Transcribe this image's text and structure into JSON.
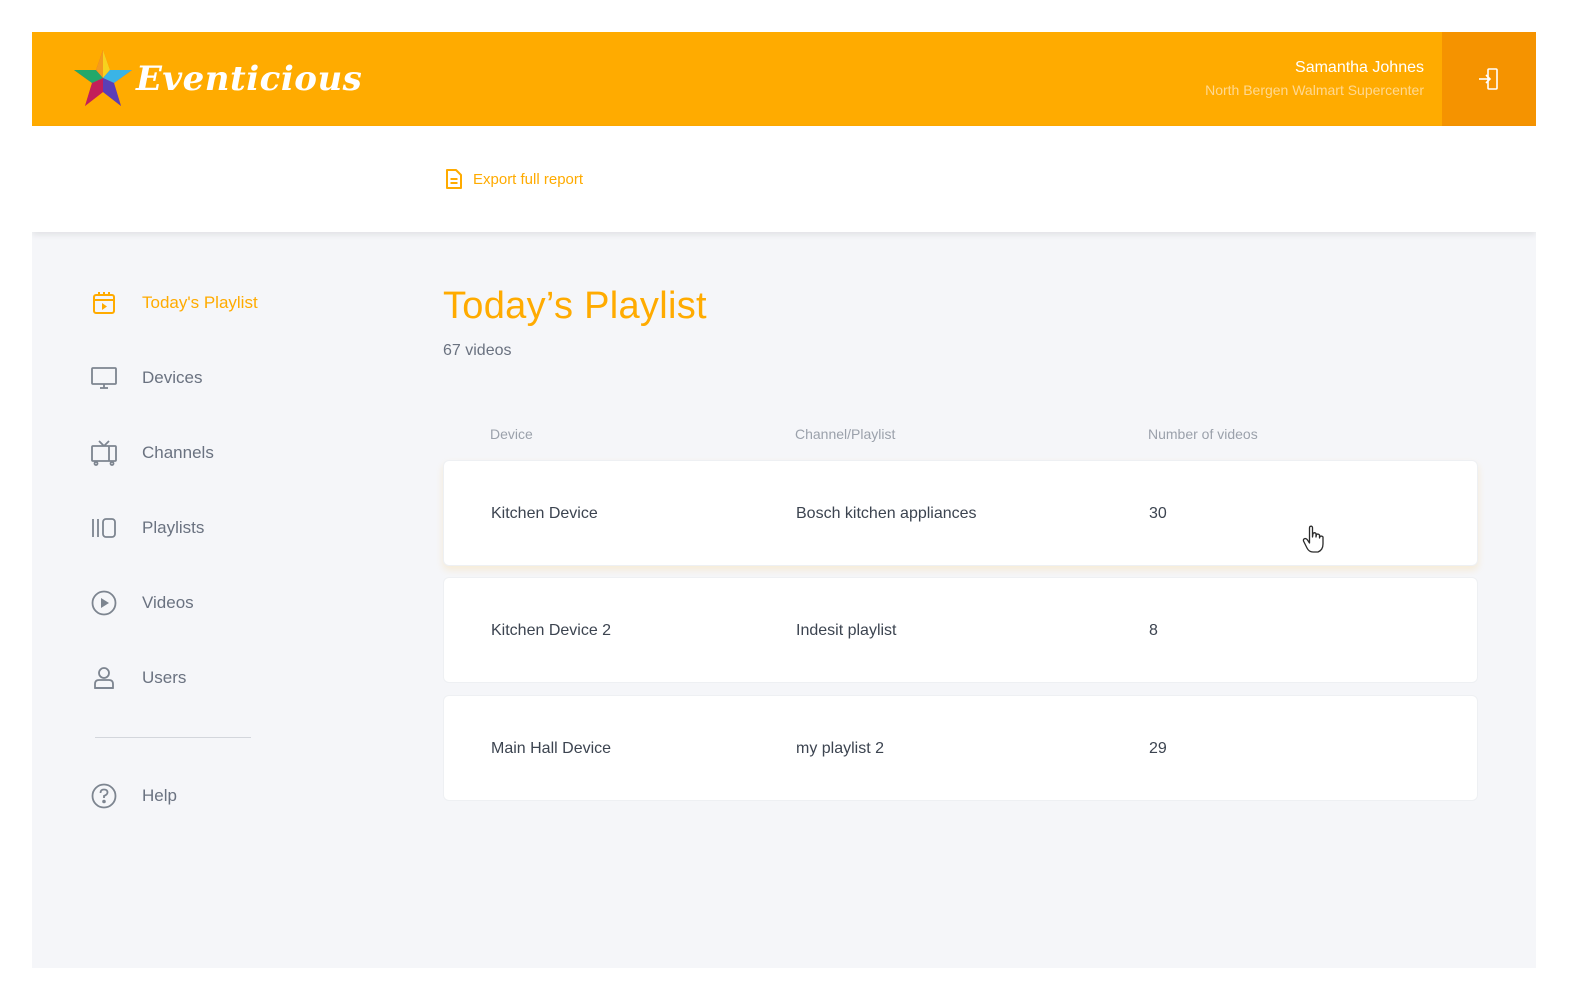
{
  "header": {
    "brand": "Eventicious",
    "user_name": "Samantha Johnes",
    "store_name": "North Bergen Walmart Supercenter",
    "logout_icon": "logout-icon"
  },
  "toolbar": {
    "export_label": "Export full report",
    "export_icon": "document-icon"
  },
  "sidebar": {
    "items": [
      {
        "label": "Today's Playlist",
        "icon": "calendar-play-icon",
        "active": true
      },
      {
        "label": "Devices",
        "icon": "monitor-icon",
        "active": false
      },
      {
        "label": "Channels",
        "icon": "tv-icon",
        "active": false
      },
      {
        "label": "Playlists",
        "icon": "playlists-icon",
        "active": false
      },
      {
        "label": "Videos",
        "icon": "play-circle-icon",
        "active": false
      },
      {
        "label": "Users",
        "icon": "user-icon",
        "active": false
      }
    ],
    "help": {
      "label": "Help",
      "icon": "help-icon"
    }
  },
  "main": {
    "title": "Today’s Playlist",
    "count": "67 videos",
    "columns": [
      "Device",
      "Channel/Playlist",
      "Number of videos"
    ],
    "rows": [
      {
        "device": "Kitchen Device",
        "playlist": "Bosch kitchen appliances",
        "videos": "30"
      },
      {
        "device": "Kitchen Device 2",
        "playlist": "Indesit playlist",
        "videos": "8"
      },
      {
        "device": "Main Hall Device",
        "playlist": "my playlist 2",
        "videos": "29"
      }
    ]
  },
  "colors": {
    "accent": "#ffab00",
    "accent_dark": "#f59300",
    "text": "#3c4450",
    "muted": "#6a7280",
    "background": "#f5f6f9"
  }
}
